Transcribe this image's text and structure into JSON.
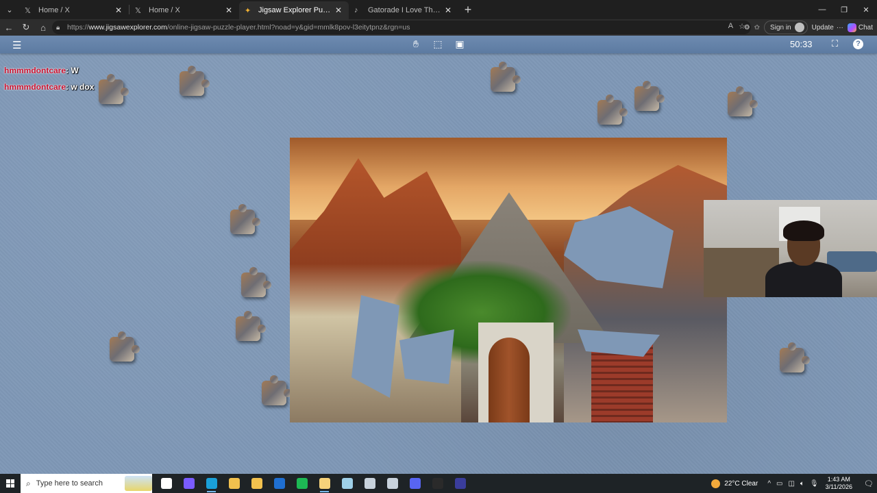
{
  "browser": {
    "tabs": [
      {
        "title": "Home / X",
        "icon": "x-logo-icon",
        "active": false
      },
      {
        "title": "Home / X",
        "icon": "x-logo-icon",
        "active": false
      },
      {
        "title": "Jigsaw Explorer Puzzle Player",
        "icon": "jigsaw-explorer-icon",
        "active": true
      },
      {
        "title": "Gatorade I Love The Way It Tastes",
        "icon": "tiktok-icon",
        "active": false
      }
    ],
    "url_prefix": "https://",
    "url_domain": "www.jigsawexplorer.com",
    "url_path": "/online-jigsaw-puzzle-player.html?noad=y&gid=mmlk8pov-l3eitytpnz&rgn=us",
    "sign_in": "Sign in",
    "update": "Update",
    "copilot": "Chat"
  },
  "puzzle_app": {
    "timer": "50:33",
    "menu_icon": "hamburger-menu-icon",
    "tools": [
      "hand-icon",
      "select-box-icon",
      "image-preview-icon"
    ]
  },
  "chat": [
    {
      "user": "hmmmdontcare",
      "separator": ":",
      "message": "W"
    },
    {
      "user": "hmmmdontcare",
      "separator": ":",
      "message": "w dox"
    }
  ],
  "taskbar": {
    "search_placeholder": "Type here to search",
    "weather": "22°C  Clear",
    "time": "1:43 AM",
    "date": "3/11/2026",
    "apps": [
      {
        "name": "task-view-icon",
        "color": "#ffffff",
        "active": false
      },
      {
        "name": "copilot-icon",
        "color": "#7a5cff",
        "active": false
      },
      {
        "name": "edge-icon",
        "color": "#1aa0d8",
        "active": true
      },
      {
        "name": "file-explorer-icon",
        "color": "#f2c14e",
        "active": false
      },
      {
        "name": "store-icon",
        "color": "#f2c14e",
        "active": false
      },
      {
        "name": "outlook-icon",
        "color": "#1f6fd1",
        "active": false
      },
      {
        "name": "spotify-icon",
        "color": "#1db954",
        "active": false
      },
      {
        "name": "notepad-icon",
        "color": "#f5d27a",
        "active": true
      },
      {
        "name": "app-icon-1",
        "color": "#9fd0e8",
        "active": false
      },
      {
        "name": "app-icon-2",
        "color": "#c8d2dc",
        "active": false
      },
      {
        "name": "app-icon-3",
        "color": "#c8d2dc",
        "active": false
      },
      {
        "name": "discord-icon",
        "color": "#5865f2",
        "active": false
      },
      {
        "name": "obs-icon",
        "color": "#2a2a2a",
        "active": false
      },
      {
        "name": "app-icon-4",
        "color": "#3a3d9c",
        "active": false
      }
    ]
  }
}
